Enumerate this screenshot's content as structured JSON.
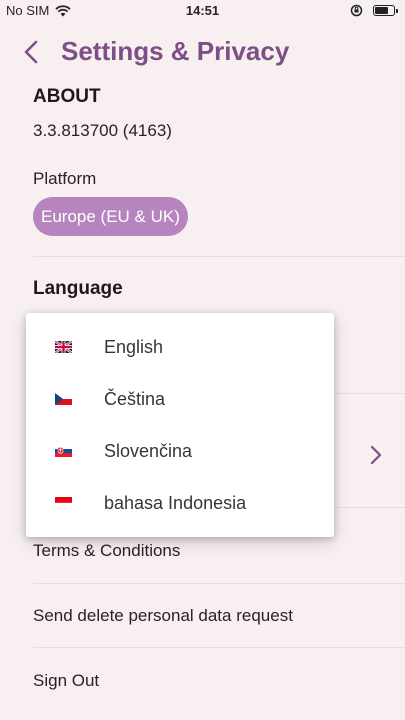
{
  "status_bar": {
    "carrier": "No SIM",
    "time": "14:51"
  },
  "header": {
    "title": "Settings & Privacy"
  },
  "about": {
    "heading": "ABOUT",
    "version": "3.3.813700 (4163)"
  },
  "platform": {
    "label": "Platform",
    "selected": "Europe (EU & UK)"
  },
  "language": {
    "heading": "Language"
  },
  "language_menu": {
    "options": [
      {
        "label": "English",
        "flag": "uk-flag-icon"
      },
      {
        "label": "Čeština",
        "flag": "czech-flag-icon"
      },
      {
        "label": "Slovenčina",
        "flag": "slovak-flag-icon"
      },
      {
        "label": "bahasa Indonesia",
        "flag": "indonesia-flag-icon"
      }
    ]
  },
  "rows": {
    "terms": "Terms & Conditions",
    "delete_request": "Send delete personal data request",
    "sign_out": "Sign Out"
  },
  "colors": {
    "accent": "#7d4f86",
    "chip_bg": "#b685bf",
    "background": "#f7eff0"
  }
}
